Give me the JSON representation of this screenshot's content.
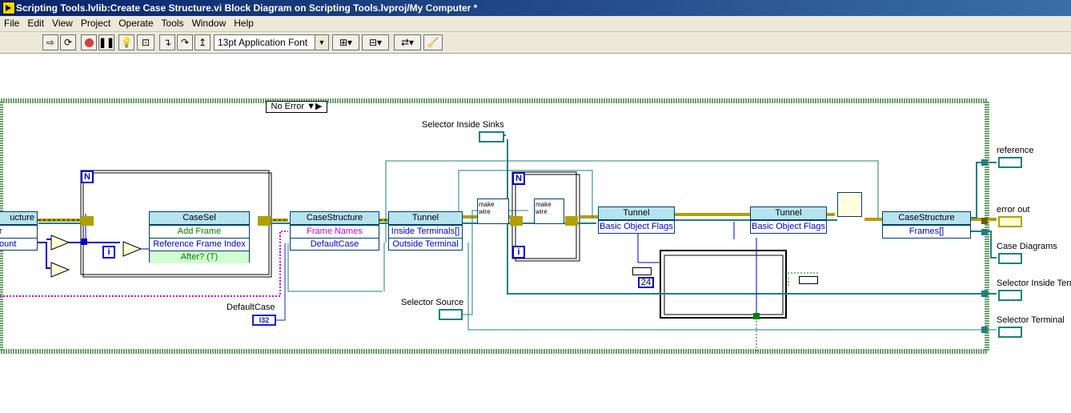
{
  "window": {
    "title": "Scripting Tools.lvlib:Create Case Structure.vi Block Diagram on Scripting Tools.lvproj/My Computer *"
  },
  "menu": {
    "items": [
      "File",
      "Edit",
      "View",
      "Project",
      "Operate",
      "Tools",
      "Window",
      "Help"
    ]
  },
  "toolbar": {
    "font": "13pt Application Font"
  },
  "diagram": {
    "case_selector": "No Error",
    "loop_count": "N",
    "iteration": "i",
    "node_casesel": {
      "header": "CaseSel",
      "rows": [
        "Add Frame",
        "Reference Frame Index",
        "After? (T)"
      ]
    },
    "node_cs1": {
      "header": "CaseStructure",
      "rows": [
        "Frame Names",
        "DefaultCase"
      ]
    },
    "node_tunnel1": {
      "header": "Tunnel",
      "rows": [
        "Inside Terminals[]",
        "Outside Terminal"
      ]
    },
    "node_tunnel2": {
      "header": "Tunnel",
      "rows": [
        "Basic Object Flags"
      ]
    },
    "node_tunnel3": {
      "header": "Tunnel",
      "rows": [
        "Basic Object Flags"
      ]
    },
    "node_cs2": {
      "header": "CaseStructure",
      "rows": [
        "Frames[]"
      ]
    },
    "left_partial": {
      "header": "ucture",
      "rows": [
        "r",
        "ount"
      ]
    },
    "make_wire": "make wire",
    "constant_24": "24",
    "labels": {
      "selector_inside_sinks": "Selector Inside Sinks",
      "default_case": "DefaultCase",
      "selector_source": "Selector Source",
      "default_case_type": "I32"
    },
    "outputs": [
      "reference",
      "error out",
      "Case Diagrams",
      "Selector Inside Term",
      "Selector Terminal"
    ]
  },
  "colors": {
    "wire_ref": "#1f7f7f",
    "wire_error": "#b0a000",
    "wire_pink": "#d000d0",
    "case_border": "#6c9f6c",
    "node_header": "#b6e3f0"
  }
}
